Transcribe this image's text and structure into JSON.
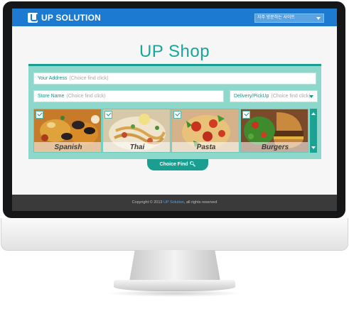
{
  "header": {
    "logo_text": "UP SOLUTION",
    "language_select": "자주 방문하는 사이트"
  },
  "main": {
    "title": "UP Shop",
    "address_field": {
      "label": "Your Address",
      "placeholder": "(Choice find click)"
    },
    "store_field": {
      "label": "Store Name",
      "placeholder": "(Choice find click)"
    },
    "delivery_field": {
      "label": "Delivery/PickUp",
      "placeholder": "(Choice find click)"
    },
    "categories": [
      {
        "label": "Spanish"
      },
      {
        "label": "Thai"
      },
      {
        "label": "Pasta"
      },
      {
        "label": "Burgers"
      }
    ],
    "choice_button": "Choice Find"
  },
  "footer": {
    "prefix": "Copyright © 2013",
    "brand": "UP Solution",
    "suffix": ", all rights reserved"
  },
  "colors": {
    "brand_blue": "#1c7bd0",
    "teal": "#1a9e90",
    "teal_light": "#8dd8cb"
  }
}
